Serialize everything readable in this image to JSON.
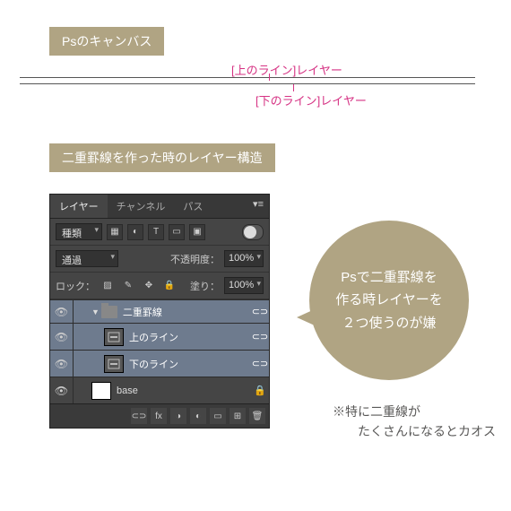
{
  "section1": {
    "badge": "Psのキャンバス",
    "top_label": "[上のライン]レイヤー",
    "bottom_label": "[下のライン]レイヤー"
  },
  "section2": {
    "badge": "二重罫線を作った時のレイヤー構造"
  },
  "panel": {
    "tabs": {
      "layers": "レイヤー",
      "channels": "チャンネル",
      "paths": "パス"
    },
    "filter_kind": "種類",
    "blend_mode": "通過",
    "opacity_label": "不透明度：",
    "opacity_value": "100%",
    "lock_label": "ロック：",
    "fill_label": "塗り：",
    "fill_value": "100%",
    "layers": {
      "group": "二重罫線",
      "top": "上のライン",
      "bottom": "下のライン",
      "base": "base"
    }
  },
  "bubble": "Psで二重罫線を\n作る時レイヤーを\n２つ使うのが嫌",
  "note": "※特に二重線が\n　　たくさんになるとカオス"
}
